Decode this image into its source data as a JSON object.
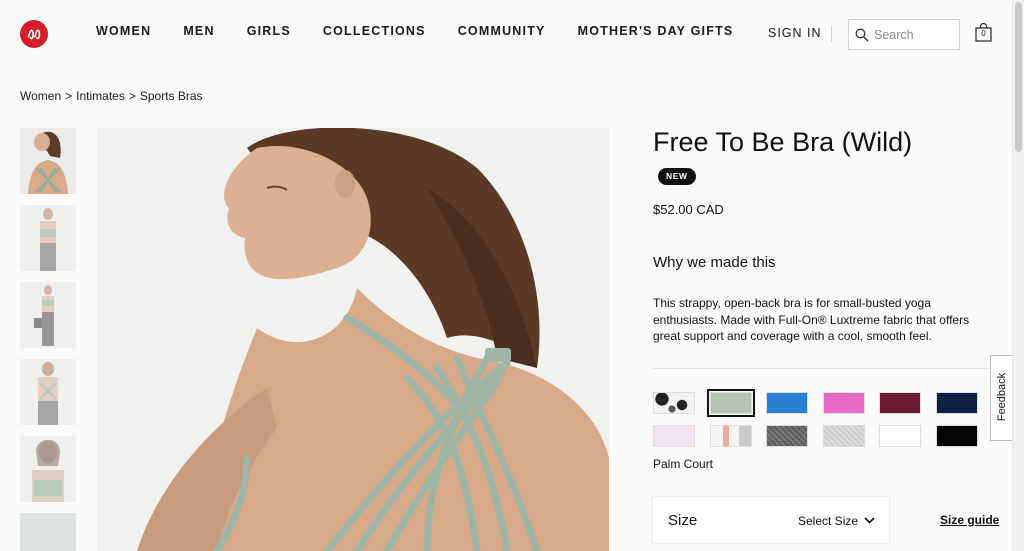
{
  "nav": {
    "items": [
      "WOMEN",
      "MEN",
      "GIRLS",
      "COLLECTIONS",
      "COMMUNITY",
      "MOTHER'S DAY GIFTS"
    ],
    "sign_in": "SIGN IN",
    "search_placeholder": "Search",
    "bag_count": "0"
  },
  "breadcrumb": [
    "Women",
    "Intimates",
    "Sports Bras"
  ],
  "breadcrumb_separator": ">",
  "product": {
    "title": "Free To Be Bra (Wild)",
    "badge": "NEW",
    "price": "$52.00 CAD",
    "why_heading": "Why we made this",
    "description": "This strappy, open-back bra is for small-busted yoga enthusiasts. Made with Full-On® Luxtreme fabric that offers great support and coverage with a cool, smooth feel.",
    "selected_color": "Palm Court",
    "size_label": "Size",
    "size_select": "Select Size",
    "size_guide": "Size guide"
  },
  "swatches": [
    {
      "color": "#9a9a9a",
      "pattern": "camo-bw"
    },
    {
      "color": "#b6c4b4",
      "selected": true
    },
    {
      "color": "#2c80d3"
    },
    {
      "color": "#e56bc4"
    },
    {
      "color": "#6e1a33"
    },
    {
      "color": "#0f2142"
    },
    {
      "color": "#f3e1ef"
    },
    {
      "color": "#d9d0cc",
      "pattern": "stripe"
    },
    {
      "color": "#6f6c6e",
      "pattern": "heather"
    },
    {
      "color": "#d4d4d4",
      "pattern": "heather-light"
    },
    {
      "color": "#ffffff"
    },
    {
      "color": "#050505"
    }
  ],
  "feedback_label": "Feedback",
  "colors": {
    "brand_red": "#d31e2d",
    "product_green": "#9fb5a5"
  }
}
